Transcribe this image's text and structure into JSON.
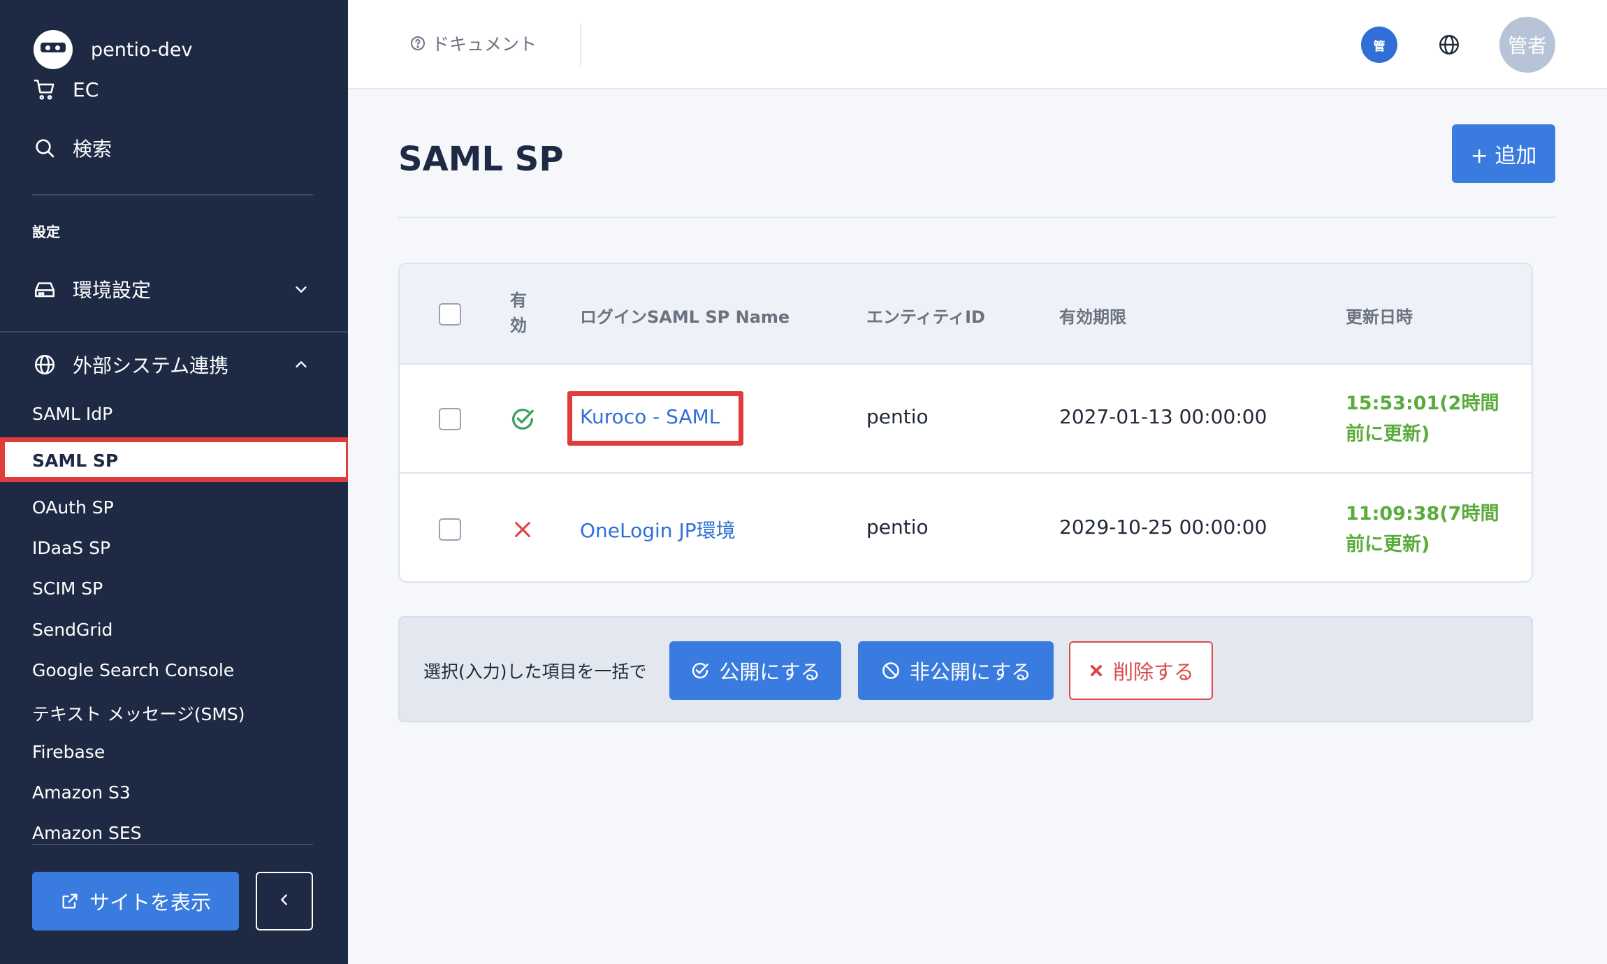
{
  "sidebar": {
    "brand": "pentio-dev",
    "top_items": [
      {
        "label": "EC",
        "icon": "cart-icon"
      },
      {
        "label": "検索",
        "icon": "search-icon"
      }
    ],
    "section_label": "設定",
    "env_settings": {
      "label": "環境設定",
      "icon": "storage-icon"
    },
    "external": {
      "label": "外部システム連携",
      "icon": "globe-icon"
    },
    "sub_items": [
      "SAML IdP",
      "SAML SP",
      "OAuth SP",
      "IDaaS SP",
      "SCIM SP",
      "SendGrid",
      "Google Search Console",
      "テキスト メッセージ(SMS)",
      "Firebase",
      "Amazon S3",
      "Amazon SES"
    ],
    "active_item": "SAML SP",
    "site_button": "サイトを表示",
    "collapse_symbol": "‹"
  },
  "header": {
    "doc_link": "ドキュメント",
    "badge": "管",
    "avatar": "管者"
  },
  "main": {
    "title": "SAML SP",
    "add_button": "+ 追加",
    "table": {
      "columns": [
        "有\n効",
        "ログインSAML SP Name",
        "エンティティID",
        "有効期限",
        "更新日時"
      ],
      "col_enabled_line1": "有",
      "col_enabled_line2": "効",
      "rows": [
        {
          "enabled": true,
          "name": "Kuroco - SAML",
          "entity_id": "pentio",
          "expires": "2027-01-13 00:00:00",
          "updated_line1": "15:53:01(2時間",
          "updated_line2": "前に更新)"
        },
        {
          "enabled": false,
          "name": "OneLogin JP環境",
          "entity_id": "pentio",
          "expires": "2029-10-25 00:00:00",
          "updated_line1": "11:09:38(7時間",
          "updated_line2": "前に更新)"
        }
      ]
    },
    "bulk": {
      "label": "選択(入力)した項目を一括で",
      "publish": "公開にする",
      "unpublish": "非公開にする",
      "delete": "削除する"
    }
  },
  "colors": {
    "sidebar_bg": "#1e2a44",
    "primary": "#3a7be0",
    "highlight": "#e03c3c",
    "updated_green": "#5aab3c",
    "check_green": "#3aa061",
    "cross_red": "#e04848"
  }
}
